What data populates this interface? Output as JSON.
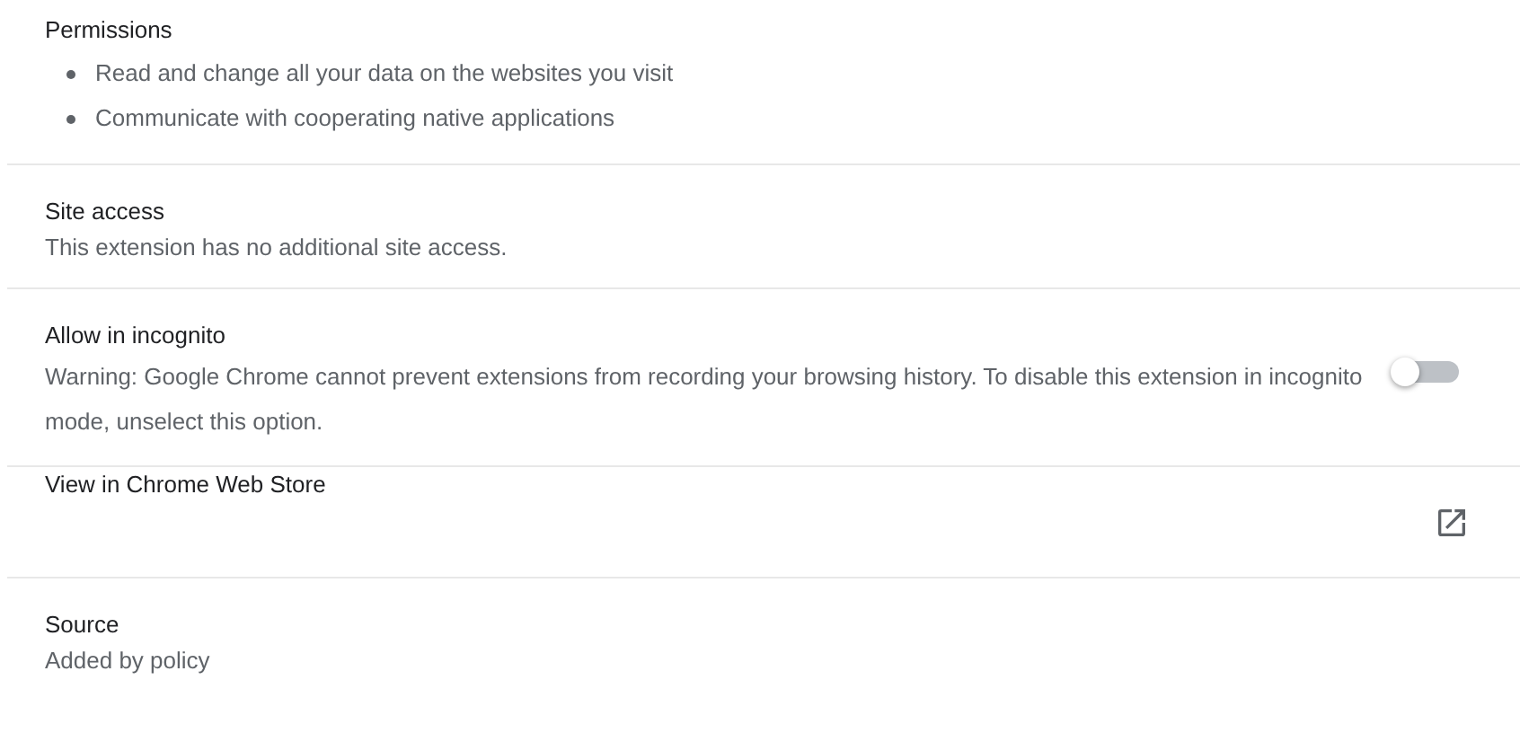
{
  "sections": [
    {
      "kind": "list",
      "title": "Permissions",
      "items": [
        "Read and change all your data on the websites you visit",
        "Communicate with cooperating native applications"
      ]
    },
    {
      "kind": "text",
      "title": "Site access",
      "text": "This extension has no additional site access."
    },
    {
      "kind": "toggle",
      "title": "Allow in incognito",
      "text": "Warning: Google Chrome cannot prevent extensions from recording your browsing history. To disable this extension in incognito mode, unselect this option.",
      "on": false
    },
    {
      "kind": "link",
      "title": "View in Chrome Web Store"
    },
    {
      "kind": "text",
      "title": "Source",
      "text": "Added by policy"
    }
  ]
}
